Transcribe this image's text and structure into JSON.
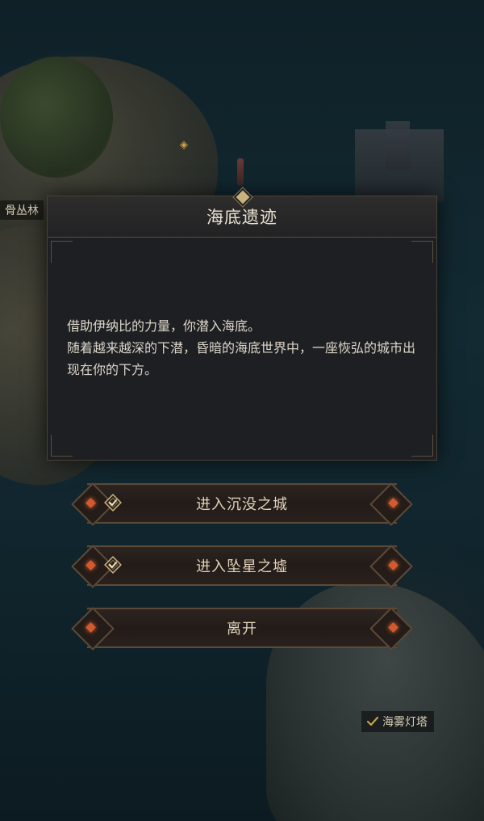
{
  "map": {
    "jungle_label": "骨丛林",
    "beacon_label": "海雾灯塔"
  },
  "dialog": {
    "title": "海底遗迹",
    "paragraph_1": "借助伊纳比的力量，你潜入海底。",
    "paragraph_2": "随着越来越深的下潜，昏暗的海底世界中，一座恢弘的城市出现在你的下方。"
  },
  "options": [
    {
      "label": "进入沉没之城",
      "completed": true
    },
    {
      "label": "进入坠星之墟",
      "completed": true
    },
    {
      "label": "离开",
      "completed": false
    }
  ],
  "colors": {
    "accent_gold": "#c9b27e",
    "gem_orange": "#d4592e",
    "text_light": "#e2d3b8"
  }
}
